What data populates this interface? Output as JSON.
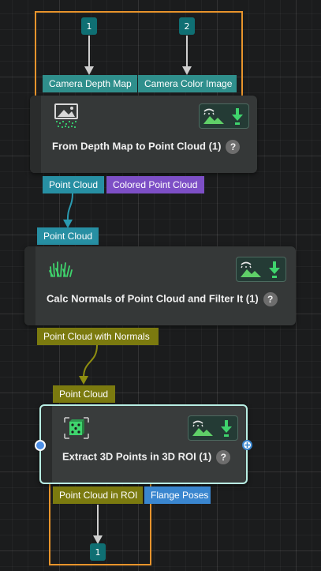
{
  "colors": {
    "background": "#1b1c1d",
    "selection_border": "#e8942c",
    "node_body": "#353838",
    "node_selected_border": "#b9efe4",
    "port_depth_map": "#2f8f8c",
    "port_point_cloud": "#278fa3",
    "port_colored_point_cloud": "#7d4fc6",
    "port_normals": "#7b7a0f",
    "port_flange_poses": "#3a86cf",
    "badge": "#0f6f73"
  },
  "inputs": [
    {
      "index": "1"
    },
    {
      "index": "2"
    }
  ],
  "nodes": [
    {
      "title": "From Depth Map to Point Cloud (1)",
      "icon": "depth-map-icon",
      "help": "?",
      "inputs": [
        "Camera Depth Map",
        "Camera Color Image"
      ],
      "outputs": [
        "Point Cloud",
        "Colored Point Cloud"
      ]
    },
    {
      "title": "Calc Normals of Point Cloud and Filter It (1)",
      "icon": "normals-icon",
      "help": "?",
      "inputs": [
        "Point Cloud"
      ],
      "outputs": [
        "Point Cloud with Normals"
      ]
    },
    {
      "title": "Extract 3D Points in 3D ROI (1)",
      "icon": "roi-cube-icon",
      "help": "?",
      "inputs": [
        "Point Cloud"
      ],
      "outputs": [
        "Point Cloud in ROI",
        "Flange Poses"
      ]
    }
  ],
  "outputs": [
    {
      "index": "1"
    }
  ]
}
